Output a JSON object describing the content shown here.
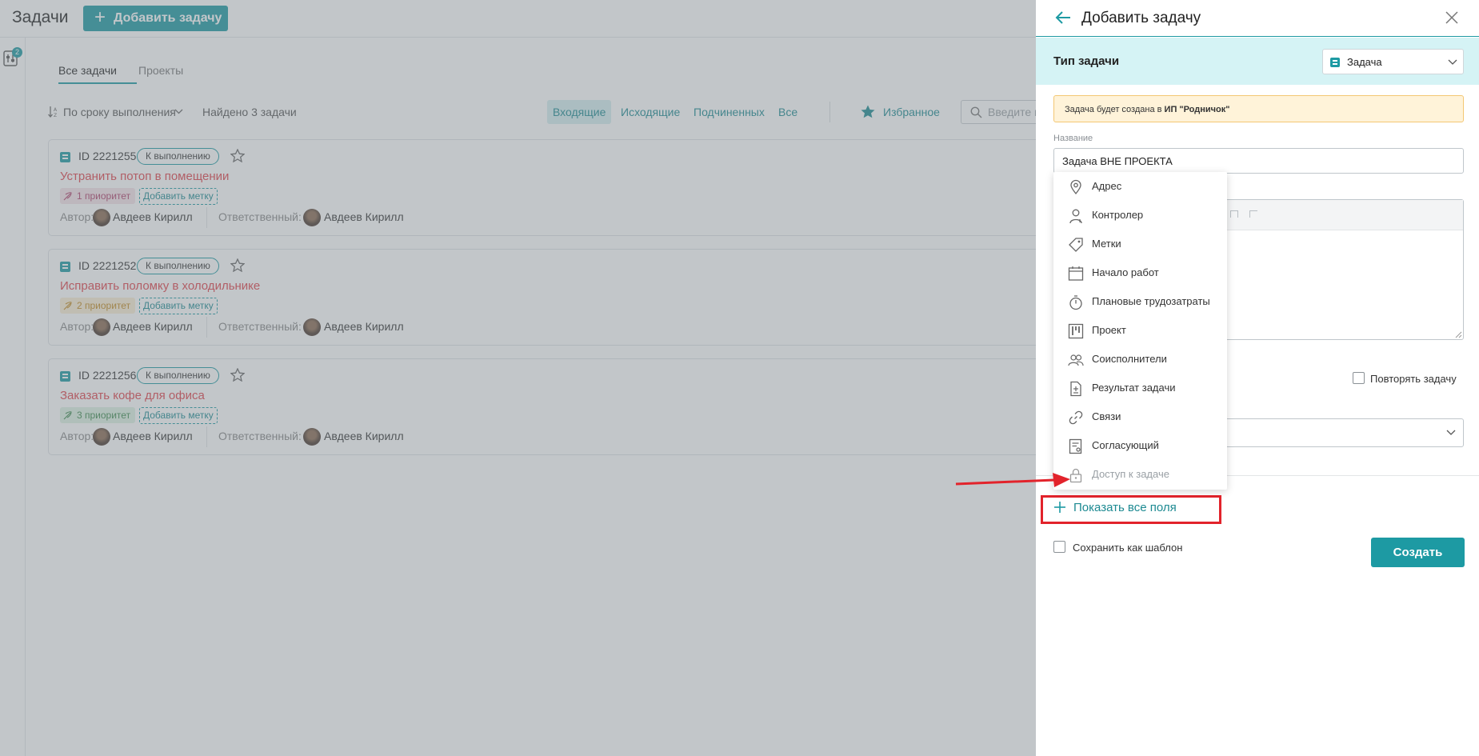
{
  "app": {
    "page_title": "Задачи",
    "add_task_button": "Добавить задачу",
    "filter_badge_count": "2"
  },
  "tabs": [
    {
      "label": "Все задачи",
      "active": true
    },
    {
      "label": "Проекты",
      "active": false
    }
  ],
  "list_toolbar": {
    "sort_label": "По сроку выполнения",
    "found_label": "Найдено 3 задачи",
    "filter_tabs": [
      "Входящие",
      "Исходящие",
      "Подчиненных",
      "Все"
    ],
    "favorites_label": "Избранное",
    "search_placeholder": "Введите п"
  },
  "tasks": [
    {
      "id": "ID 2221255",
      "status": "К выполнению",
      "title": "Устранить потоп в помещении",
      "priority": "1 приоритет",
      "add_tag": "Добавить метку",
      "author_label": "Автор:",
      "author": "Авдеев Кирилл",
      "assignee_label": "Ответственный:",
      "assignee": "Авдеев Кирилл"
    },
    {
      "id": "ID 2221252",
      "status": "К выполнению",
      "title": "Исправить поломку в холодильнике",
      "priority": "2 приоритет",
      "add_tag": "Добавить метку",
      "author_label": "Автор:",
      "author": "Авдеев Кирилл",
      "assignee_label": "Ответственный:",
      "assignee": "Авдеев Кирилл"
    },
    {
      "id": "ID 2221256",
      "status": "К выполнению",
      "title": "Заказать кофе для офиса",
      "priority": "3 приоритет",
      "add_tag": "Добавить метку",
      "author_label": "Автор:",
      "author": "Авдеев Кирилл",
      "assignee_label": "Ответственный:",
      "assignee": "Авдеев Кирилл"
    }
  ],
  "panel": {
    "title": "Добавить задачу",
    "type_label": "Тип задачи",
    "type_value": "Задача",
    "notice_prefix": "Задача будет создана в ",
    "notice_org": "ИП \"Родничок\"",
    "name_label": "Название",
    "name_value": "Задача ВНЕ ПРОЕКТА",
    "repeat_label": "Повторять задачу",
    "show_all_fields": "Показать все поля",
    "save_template_label": "Сохранить как шаблон",
    "create_button": "Создать"
  },
  "fields_dropdown": [
    {
      "label": "Адрес",
      "icon": "location-pin-icon",
      "disabled": false
    },
    {
      "label": "Контролер",
      "icon": "user-plus-icon",
      "disabled": false
    },
    {
      "label": "Метки",
      "icon": "tag-icon",
      "disabled": false
    },
    {
      "label": "Начало работ",
      "icon": "calendar-icon",
      "disabled": false
    },
    {
      "label": "Плановые трудозатраты",
      "icon": "stopwatch-icon",
      "disabled": false
    },
    {
      "label": "Проект",
      "icon": "kanban-icon",
      "disabled": false
    },
    {
      "label": "Соисполнители",
      "icon": "users-icon",
      "disabled": false
    },
    {
      "label": "Результат задачи",
      "icon": "document-result-icon",
      "disabled": false
    },
    {
      "label": "Связи",
      "icon": "link-icon",
      "disabled": false
    },
    {
      "label": "Согласующий",
      "icon": "approval-document-icon",
      "disabled": false
    },
    {
      "label": "Доступ к задаче",
      "icon": "lock-icon",
      "disabled": true
    }
  ],
  "colors": {
    "accent": "#1d9aa3",
    "title_red": "#e0434b",
    "annotation_red": "#e2232b",
    "type_bar_bg": "#d5f3f5",
    "notice_bg": "#fff3d9"
  }
}
